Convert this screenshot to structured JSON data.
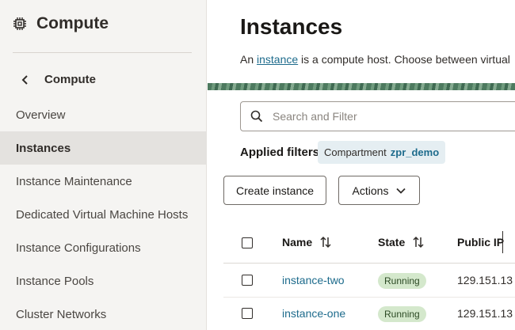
{
  "sidebar": {
    "title": "Compute",
    "back_label": "Compute",
    "items": [
      {
        "label": "Overview"
      },
      {
        "label": "Instances"
      },
      {
        "label": "Instance Maintenance"
      },
      {
        "label": "Dedicated Virtual Machine Hosts"
      },
      {
        "label": "Instance Configurations"
      },
      {
        "label": "Instance Pools"
      },
      {
        "label": "Cluster Networks"
      }
    ],
    "active_item": "Instances"
  },
  "main": {
    "title": "Instances",
    "intro_prefix": "An ",
    "intro_link": "instance",
    "intro_suffix": " is a compute host. Choose between virtual",
    "search_placeholder": "Search and Filter",
    "applied_filters_label": "Applied filters",
    "filter_chip": {
      "key": "Compartment",
      "value": "zpr_demo"
    },
    "create_button": "Create instance",
    "actions_button": "Actions",
    "table": {
      "columns": [
        "Name",
        "State",
        "Public IP"
      ],
      "rows": [
        {
          "name": "instance-two",
          "state": "Running",
          "public_ip": "129.151.13"
        },
        {
          "name": "instance-one",
          "state": "Running",
          "public_ip": "129.151.13"
        }
      ]
    }
  },
  "colors": {
    "link": "#1d6b8c",
    "running_badge": "#d4e8cc",
    "sidebar_bg": "#f5f4f2",
    "active_item_bg": "#e4e2df",
    "chip_bg": "#e5eef2"
  }
}
